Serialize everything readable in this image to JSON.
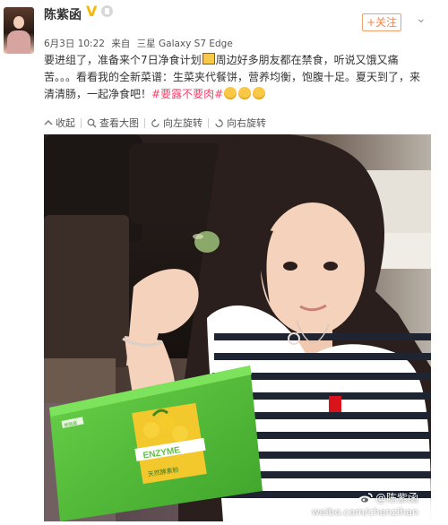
{
  "author": {
    "name": "陈紫函",
    "verified_mark": "V"
  },
  "follow_label": "+关注",
  "more_glyph": "⌄",
  "meta": {
    "date": "6月3日 10:22",
    "source_prefix": "来自",
    "device": "三星 Galaxy S7 Edge"
  },
  "post": {
    "line1_a": "要进组了，准备来个7日净食计划",
    "line1_b": "周边好多朋友都在禁食，听说又饿又痛苦。。。看看我的全新菜谱：生菜夹代餐饼，营养均衡，饱腹十足。夏天到了，来清清肠，一起净食吧！",
    "hashtag": "#要露不要肉#"
  },
  "toolbar": {
    "collapse": "收起",
    "view_large": "查看大图",
    "rotate_left": "向左旋转",
    "rotate_right": "向右旋转"
  },
  "photo": {
    "box_brand": "ENZYME",
    "box_sub": "天然酵素粉",
    "box_tag": "体验装",
    "watermark_handle": "@陈紫函",
    "watermark_url": "weibo.com/chenzihan"
  },
  "colors": {
    "follow": "#ff8140",
    "hashtag": "#ff3c6b",
    "box_green": "#5cc33c",
    "box_yellow": "#f2c82c"
  },
  "icons": [
    "collapse-icon",
    "magnifier-icon",
    "rotate-left-icon",
    "rotate-right-icon",
    "weibo-logo-icon",
    "vip-badge-icon",
    "member-icon"
  ]
}
